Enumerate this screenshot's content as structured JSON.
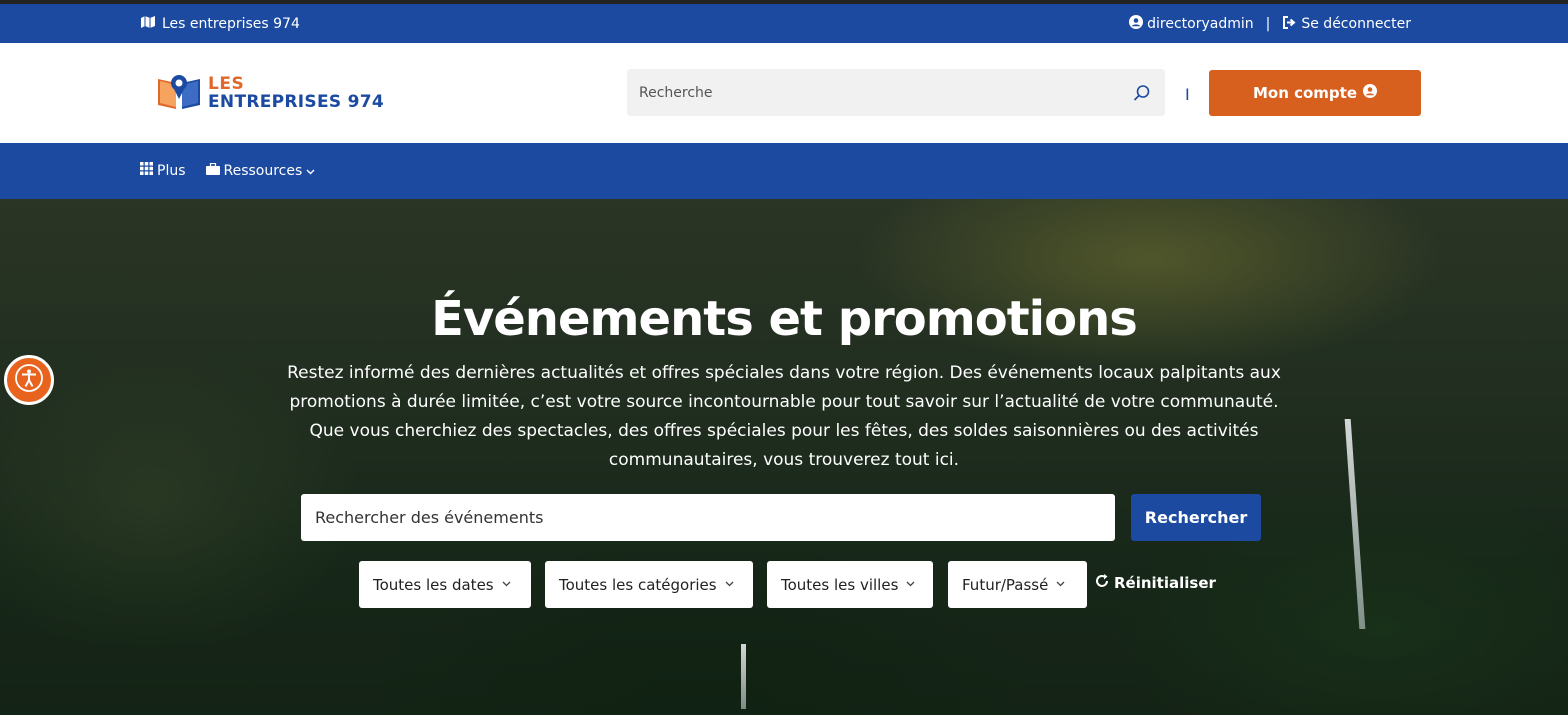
{
  "topbar": {
    "brand": "Les entreprises 974",
    "user": "directoryadmin",
    "separator": "|",
    "logout": "Se déconnecter"
  },
  "header": {
    "logo_line1": "LES",
    "logo_line2": "ENTREPRISES 974",
    "search_placeholder": "Recherche",
    "divider": "I",
    "account_label": "Mon compte"
  },
  "nav": {
    "items": [
      {
        "label": "Plus",
        "icon": "grid-icon"
      },
      {
        "label": "Ressources",
        "icon": "briefcase-icon"
      }
    ]
  },
  "hero": {
    "title": "Événements et promotions",
    "description": "Restez informé des dernières actualités et offres spéciales dans votre région. Des événements locaux palpitants aux promotions à durée limitée, c’est votre source incontournable pour tout savoir sur l’actualité de votre communauté. Que vous cherchiez des spectacles, des offres spéciales pour les fêtes, des soldes saisonnières ou des activités communautaires, vous trouverez tout ici.",
    "search_placeholder": "Rechercher des événements",
    "search_button": "Rechercher"
  },
  "filters": {
    "dates": "Toutes les dates",
    "categories": "Toutes les catégories",
    "cities": "Toutes les villes",
    "period": "Futur/Passé",
    "reset": "Réinitialiser"
  },
  "colors": {
    "primary_blue": "#1b4aa0",
    "accent_orange": "#d8601e"
  }
}
